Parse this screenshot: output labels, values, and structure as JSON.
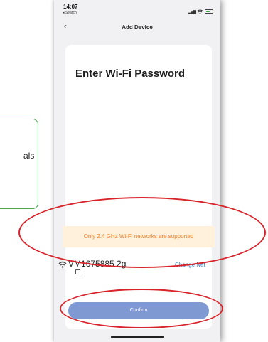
{
  "status_bar": {
    "time": "14:07",
    "back_label": "◂ Search"
  },
  "nav": {
    "title": "Add Device",
    "back_icon": "chevron-left-icon"
  },
  "card": {
    "title": "Enter Wi-Fi Password"
  },
  "warning": {
    "text": "Only 2.4 GHz Wi-Fi networks are supported"
  },
  "network": {
    "ssid": "VM1675885 2g",
    "change_label": "Change Net"
  },
  "confirm": {
    "label": "Confirm"
  },
  "callout": {
    "text": "als"
  },
  "colors": {
    "warning_bg": "#fff1dc",
    "warning_text": "#f0802a",
    "button": "#7f9ad3",
    "link": "#3a78c7",
    "annotation": "#d9232a",
    "callout_border": "#49a94f"
  }
}
